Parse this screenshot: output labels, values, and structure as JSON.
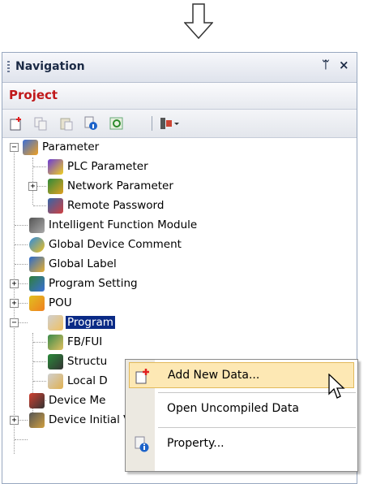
{
  "panel": {
    "title": "Navigation",
    "pin_glyph": "ᛠ",
    "close_glyph": "×",
    "project_label": "Project"
  },
  "toolbar": {
    "icons": [
      "new-data-icon",
      "copy-icon",
      "paste-icon",
      "property-icon",
      "refresh-icon",
      "filter-icon"
    ]
  },
  "tree": {
    "parameter": "Parameter",
    "plc_parameter": "PLC Parameter",
    "network_parameter": "Network Parameter",
    "remote_password": "Remote Password",
    "intelligent_function_module": "Intelligent Function Module",
    "global_device_comment": "Global Device Comment",
    "global_label": "Global Label",
    "program_setting": "Program Setting",
    "pou": "POU",
    "program": "Program",
    "fb_fun": "FB/FUI",
    "structured": "Structu",
    "local_device": "Local D",
    "device_memory": "Device Me",
    "device_initial_value": "Device Initial Value"
  },
  "context_menu": {
    "add_new_data": "Add New Data...",
    "open_uncompiled_data": "Open Uncompiled Data",
    "property": "Property..."
  },
  "colors": {
    "selection": "#0a2a86",
    "menu_highlight": "#fde8b4",
    "project_label": "#c0181a"
  }
}
